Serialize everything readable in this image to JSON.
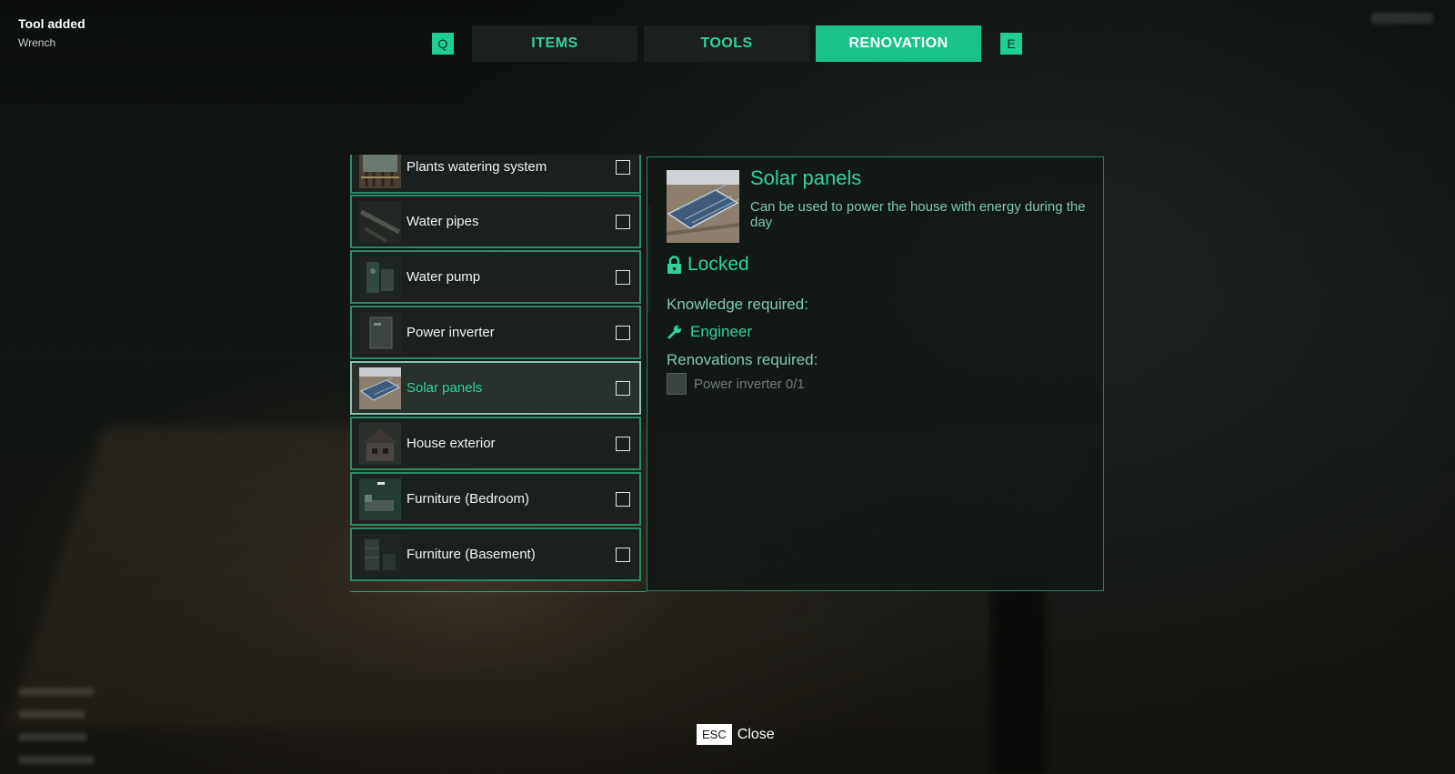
{
  "notification": {
    "title": "Tool added",
    "subtitle": "Wrench"
  },
  "tabs": {
    "prev_key": "Q",
    "next_key": "E",
    "items": [
      {
        "label": "ITEMS",
        "active": false
      },
      {
        "label": "TOOLS",
        "active": false
      },
      {
        "label": "RENOVATION",
        "active": true
      }
    ]
  },
  "renovations": [
    {
      "label": "Plants watering system",
      "icon": "plants-watering-thumbnail",
      "checked": false,
      "selected": false
    },
    {
      "label": "Water pipes",
      "icon": "water-pipes-thumbnail",
      "checked": false,
      "selected": false
    },
    {
      "label": "Water pump",
      "icon": "water-pump-thumbnail",
      "checked": false,
      "selected": false
    },
    {
      "label": "Power inverter",
      "icon": "power-inverter-thumbnail",
      "checked": false,
      "selected": false
    },
    {
      "label": "Solar panels",
      "icon": "solar-panels-thumbnail",
      "checked": false,
      "selected": true
    },
    {
      "label": "House exterior",
      "icon": "house-exterior-thumbnail",
      "checked": false,
      "selected": false
    },
    {
      "label": "Furniture (Bedroom)",
      "icon": "bedroom-thumbnail",
      "checked": false,
      "selected": false
    },
    {
      "label": "Furniture (Basement)",
      "icon": "basement-thumbnail",
      "checked": false,
      "selected": false
    }
  ],
  "detail": {
    "title": "Solar panels",
    "description": "Can be used to power the house with energy during the day",
    "status": "Locked",
    "knowledge_label": "Knowledge required:",
    "knowledge": "Engineer",
    "renovations_label": "Renovations required:",
    "renovation_required": "Power inverter 0/1"
  },
  "footer": {
    "key": "ESC",
    "label": "Close"
  },
  "colors": {
    "accent": "#19c28a",
    "accent_text": "#2fd49b",
    "muted_text": "#7fc9ad",
    "panel": "#1a201d"
  }
}
